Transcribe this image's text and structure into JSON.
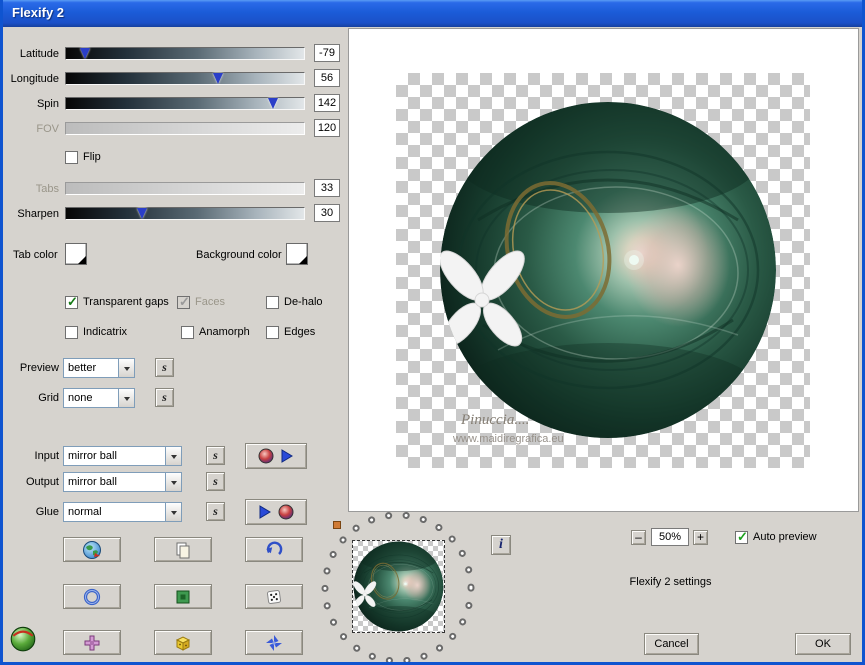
{
  "window": {
    "title": "Flexify 2"
  },
  "sliders": [
    {
      "label": "Latitude",
      "value": "-79",
      "pos": 8,
      "enabled": true
    },
    {
      "label": "Longitude",
      "value": "56",
      "pos": 64,
      "enabled": true
    },
    {
      "label": "Spin",
      "value": "142",
      "pos": 87,
      "enabled": true
    },
    {
      "label": "FOV",
      "value": "120",
      "pos": -1,
      "enabled": false
    },
    {
      "label": "Tabs",
      "value": "33",
      "pos": -1,
      "enabled": false
    },
    {
      "label": "Sharpen",
      "value": "30",
      "pos": 32,
      "enabled": true
    }
  ],
  "checkboxes": {
    "flip": {
      "label": "Flip",
      "checked": false
    },
    "transparent_gaps": {
      "label": "Transparent gaps",
      "checked": true
    },
    "faces": {
      "label": "Faces",
      "checked": true,
      "disabled": true
    },
    "de_halo": {
      "label": "De-halo",
      "checked": false
    },
    "indicatrix": {
      "label": "Indicatrix",
      "checked": false
    },
    "anamorph": {
      "label": "Anamorph",
      "checked": false
    },
    "edges": {
      "label": "Edges",
      "checked": false
    },
    "auto_preview": {
      "label": "Auto preview",
      "checked": true
    }
  },
  "colors": {
    "tab_color_label": "Tab color",
    "background_color_label": "Background color",
    "tab_color": "#ffffff",
    "background_color": "#ffffff"
  },
  "dropdowns": {
    "preview": {
      "label": "Preview",
      "value": "better"
    },
    "grid": {
      "label": "Grid",
      "value": "none"
    },
    "input": {
      "label": "Input",
      "value": "mirror ball"
    },
    "output": {
      "label": "Output",
      "value": "mirror ball"
    },
    "glue": {
      "label": "Glue",
      "value": "normal"
    }
  },
  "misc": {
    "random_glyph": "s",
    "info_glyph": "i",
    "zoom_minus": "–",
    "zoom_plus": "+",
    "zoom_value": "50%"
  },
  "preview": {
    "watermark_line1": "Pinuccia....",
    "watermark_line2": "www.maidiregrafica.eu",
    "settings_text": "Flexify 2 settings"
  },
  "actions": {
    "cancel": "Cancel",
    "ok": "OK"
  },
  "icons": {
    "button_grid": [
      "globe",
      "copy",
      "undo",
      "ring",
      "green-square",
      "dice",
      "purple-cross",
      "yellow-cube",
      "blue-pinwheel"
    ],
    "corner": "green-sphere",
    "input_action": "sphere-play",
    "glue_action": "play-sphere"
  }
}
